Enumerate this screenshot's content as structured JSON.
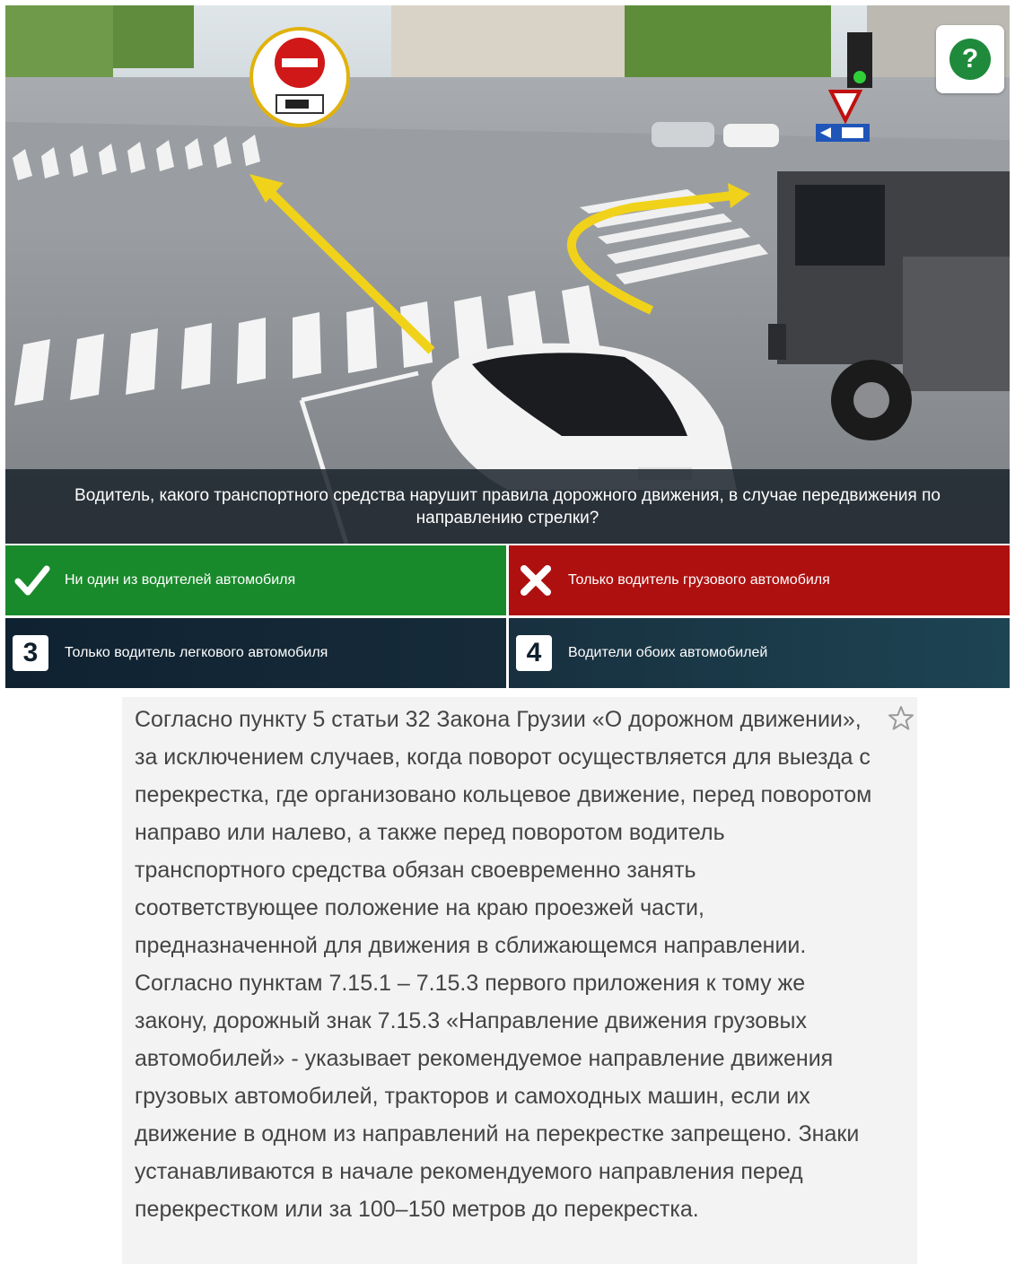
{
  "question": {
    "text": "Водитель, какого транспортного средства нарушит правила дорожного движения, в случае передвижения по направлению стрелки?"
  },
  "help": {
    "label": "?",
    "icon": "question-icon"
  },
  "answers": [
    {
      "marker": "check-icon",
      "label": "Ни один из водителей автомобиля",
      "state": "correct",
      "color": "#198a2c"
    },
    {
      "marker": "cross-icon",
      "label": "Только водитель грузового автомобиля",
      "state": "wrong",
      "color": "#ae1010"
    },
    {
      "marker": "3",
      "label": "Только водитель легкового автомобиля",
      "state": "neutral"
    },
    {
      "marker": "4",
      "label": "Водители обоих автомобилей",
      "state": "neutral"
    }
  ],
  "explanation": {
    "text": "Согласно пункту 5 статьи 32 Закона Грузии «О дорожном движении», за исключением случаев, когда поворот осуществляется для выезда с перекрестка, где организовано кольцевое движение, перед поворотом направо или налево, а также перед поворотом водитель транспортного средства обязан своевременно занять соответствующее положение на краю проезжей части, предназначенной для движения в сближающемся направлении. Согласно пунктам 7.15.1 – 7.15.3 первого приложения к тому же закону, дорожный знак 7.15.3 «Направление движения грузовых автомобилей» - указывает рекомендуемое направление движения грузовых автомобилей, тракторов и самоходных машин, если их движение в одном из направлений на перекрестке запрещено. Знаки устанавливаются в начале рекомендуемого направления перед перекрестком или за 100–150 метров до перекрестка.",
    "favorite_icon": "star-icon"
  }
}
